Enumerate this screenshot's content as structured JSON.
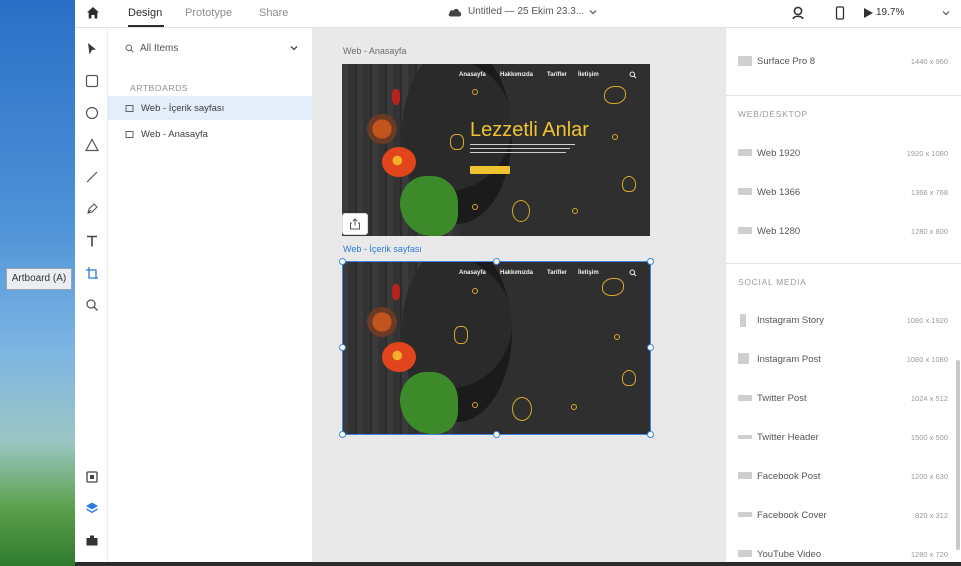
{
  "desktop": {
    "tooltip": "Artboard (A)"
  },
  "topbar": {
    "tabs": [
      "Design",
      "Prototype",
      "Share"
    ],
    "active_tab": "Design",
    "document_title": "Untitled — 25 Ekim 23.3...",
    "zoom": "19.7%"
  },
  "layers": {
    "filter_label": "All Items",
    "section_label": "ARTBOARDS",
    "items": [
      {
        "label": "Web - İçerik sayfası",
        "selected": true
      },
      {
        "label": "Web - Anasayfa",
        "selected": false
      }
    ]
  },
  "canvas": {
    "artboards": [
      {
        "label": "Web - Anasayfa",
        "nav": [
          "Anasayfa",
          "Hakkımızda",
          "Tarifler",
          "İletişim"
        ],
        "hero_title": "Lezzetli Anlar",
        "selected": false
      },
      {
        "label": "Web - İçerik sayfası",
        "nav": [
          "Anasayfa",
          "Hakkımızda",
          "Tarifler",
          "İletişim"
        ],
        "hero_title": "",
        "selected": true
      }
    ]
  },
  "presets": {
    "top_item": {
      "name": "Surface Pro 8",
      "size": "1440 x 960"
    },
    "sections": [
      {
        "title": "WEB/DESKTOP",
        "items": [
          {
            "name": "Web 1920",
            "size": "1920 x 1080"
          },
          {
            "name": "Web 1366",
            "size": "1366 x 768"
          },
          {
            "name": "Web 1280",
            "size": "1280 x 800"
          }
        ]
      },
      {
        "title": "SOCIAL MEDIA",
        "items": [
          {
            "name": "Instagram Story",
            "size": "1080 x 1920"
          },
          {
            "name": "Instagram Post",
            "size": "1080 x 1080"
          },
          {
            "name": "Twitter Post",
            "size": "1024 x 512"
          },
          {
            "name": "Twitter Header",
            "size": "1500 x 500"
          },
          {
            "name": "Facebook Post",
            "size": "1200 x 630"
          },
          {
            "name": "Facebook Cover",
            "size": "820 x 312"
          },
          {
            "name": "YouTube Video",
            "size": "1280 x 720"
          }
        ]
      }
    ]
  },
  "colors": {
    "accent": "#3d86e0",
    "artboard_bg": "#2f2f2f",
    "brand_yellow": "#f2c330"
  }
}
